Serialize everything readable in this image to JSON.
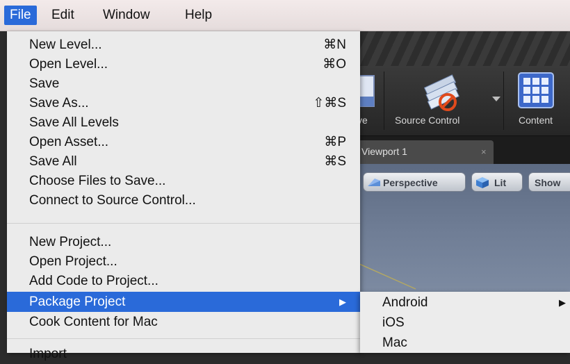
{
  "menubar": {
    "items": [
      {
        "label": "File",
        "active": true
      },
      {
        "label": "Edit"
      },
      {
        "label": "Window"
      },
      {
        "label": "Help"
      }
    ]
  },
  "file_menu": {
    "group1": [
      {
        "label": "New Level...",
        "shortcut": "⌘N"
      },
      {
        "label": "Open Level...",
        "shortcut": "⌘O"
      },
      {
        "label": "Save",
        "shortcut": ""
      },
      {
        "label": "Save As...",
        "shortcut": "⇧⌘S"
      },
      {
        "label": "Save All Levels",
        "shortcut": ""
      },
      {
        "label": "Open Asset...",
        "shortcut": "⌘P"
      },
      {
        "label": "Save All",
        "shortcut": "⌘S"
      },
      {
        "label": "Choose Files to Save...",
        "shortcut": ""
      },
      {
        "label": "Connect to Source Control...",
        "shortcut": ""
      }
    ],
    "group2": [
      {
        "label": "New Project..."
      },
      {
        "label": "Open Project..."
      },
      {
        "label": "Add Code to Project..."
      },
      {
        "label": "Package Project",
        "submenu_arrow": "▶",
        "highlighted": true
      },
      {
        "label": "Cook Content for Mac"
      }
    ],
    "group3": [
      {
        "label": "Import"
      }
    ]
  },
  "submenu": {
    "items": [
      {
        "label": "Android",
        "arrow": "▶"
      },
      {
        "label": "iOS"
      },
      {
        "label": "Mac"
      }
    ]
  },
  "editor": {
    "toolbar": {
      "partial_label": "ve",
      "source_control_label": "Source Control",
      "content_label": "Content"
    },
    "tab": {
      "label": "Viewport 1",
      "close": "×"
    },
    "viewport_buttons": {
      "perspective": "Perspective",
      "lit": "Lit",
      "show": "Show"
    }
  },
  "colors": {
    "highlight": "#2a6ad9",
    "menu_bg": "#ebebeb",
    "editor_bg": "#2b2b2b"
  }
}
